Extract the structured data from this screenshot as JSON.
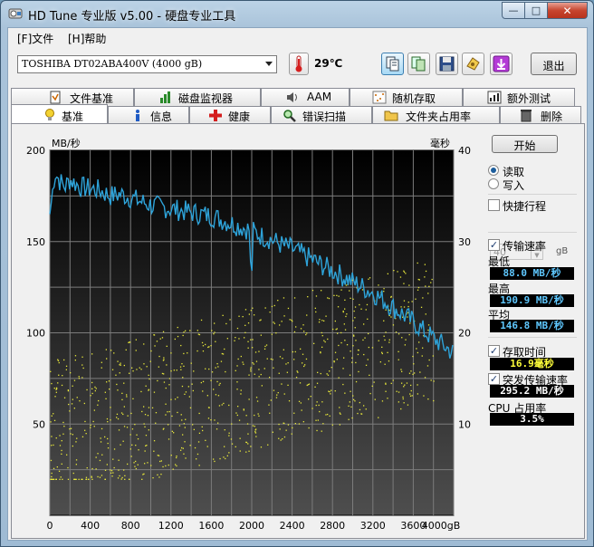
{
  "window": {
    "title": "HD Tune 专业版 v5.00 - 硬盘专业工具",
    "controls": {
      "minimize": "—",
      "maximize": "□",
      "close": "✕"
    }
  },
  "menu": [
    {
      "label": "[F]文件"
    },
    {
      "label": "[H]帮助"
    }
  ],
  "toolbar": {
    "drive": "TOSHIBA DT02ABA400V (4000 gB)",
    "temperature": "29℃",
    "exit_label": "退出",
    "icons": [
      "copy-text-icon",
      "copy-screenshot-icon",
      "save-icon",
      "options-icon",
      "download-icon"
    ]
  },
  "tabs_top": [
    {
      "label": "文件基准",
      "icon": "file-benchmark-icon"
    },
    {
      "label": "磁盘监视器",
      "icon": "disk-monitor-icon"
    },
    {
      "label": "AAM",
      "icon": "speaker-icon"
    },
    {
      "label": "随机存取",
      "icon": "random-access-icon"
    },
    {
      "label": "额外测试",
      "icon": "extra-tests-icon"
    }
  ],
  "tabs_bottom": [
    {
      "label": "基准",
      "icon": "lightbulb-icon",
      "selected": true
    },
    {
      "label": "信息",
      "icon": "info-icon"
    },
    {
      "label": "健康",
      "icon": "health-cross-icon"
    },
    {
      "label": "错误扫描",
      "icon": "magnifier-icon"
    },
    {
      "label": "文件夹占用率",
      "icon": "folder-icon"
    },
    {
      "label": "删除",
      "icon": "trash-icon"
    }
  ],
  "side": {
    "start": "开始",
    "read": "读取",
    "write": "写入",
    "mode": "read",
    "short_stroke": "快捷行程",
    "short_stroke_checked": false,
    "short_stroke_value": "40",
    "short_stroke_unit": "gB",
    "transfer_rate": "传输速率",
    "transfer_rate_checked": true,
    "min_label": "最低",
    "min_value": "88.0 MB/秒",
    "max_label": "最高",
    "max_value": "190.9 MB/秒",
    "avg_label": "平均",
    "avg_value": "146.8 MB/秒",
    "access_label": "存取时间",
    "access_checked": true,
    "access_value": "16.9毫秒",
    "burst_label": "突发传输速率",
    "burst_checked": true,
    "burst_value": "295.2 MB/秒",
    "cpu_label": "CPU 占用率",
    "cpu_value": "3.5%"
  },
  "chart_data": {
    "type": "line",
    "ylabel_left": "MB/秒",
    "ylabel_right": "毫秒",
    "x_unit": "gB",
    "xlim": [
      0,
      4000
    ],
    "ylim_left": [
      0,
      200
    ],
    "ylim_right": [
      0,
      40
    ],
    "x_ticks": [
      "0",
      "400",
      "800",
      "1200",
      "1600",
      "2000",
      "2400",
      "2800",
      "3200",
      "3600",
      "4000gB"
    ],
    "y_ticks_left": [
      "50",
      "100",
      "150",
      "200"
    ],
    "y_ticks_right": [
      "10",
      "20",
      "30",
      "40"
    ],
    "grid": true,
    "series": [
      {
        "values_x": [
          0,
          50,
          100,
          150,
          200,
          300,
          400,
          500,
          600,
          700,
          800,
          900,
          1000,
          1100,
          1200,
          1300,
          1400,
          1500,
          1600,
          1700,
          1800,
          1900,
          2000,
          2100,
          2200,
          2300,
          2400,
          2500,
          2600,
          2700,
          2800,
          2900,
          3000,
          3100,
          3200,
          3300,
          3400,
          3500,
          3600,
          3700,
          3800,
          3900,
          4000
        ],
        "values_y": [
          165,
          188,
          183,
          180,
          184,
          180,
          179,
          178,
          175,
          176,
          174,
          172,
          170,
          169,
          168,
          167,
          166,
          165,
          164,
          162,
          160,
          158,
          156,
          153,
          151,
          148,
          146,
          143,
          140,
          137,
          134,
          131,
          128,
          125,
          122,
          118,
          114,
          110,
          106,
          101,
          97,
          93,
          89
        ],
        "color": "#2ea3d9"
      },
      {
        "type": "scatter",
        "description_unit": "ms",
        "range_x": [
          0,
          3800
        ],
        "range_y": [
          4,
          32
        ],
        "color": "#e8e83a"
      }
    ]
  }
}
